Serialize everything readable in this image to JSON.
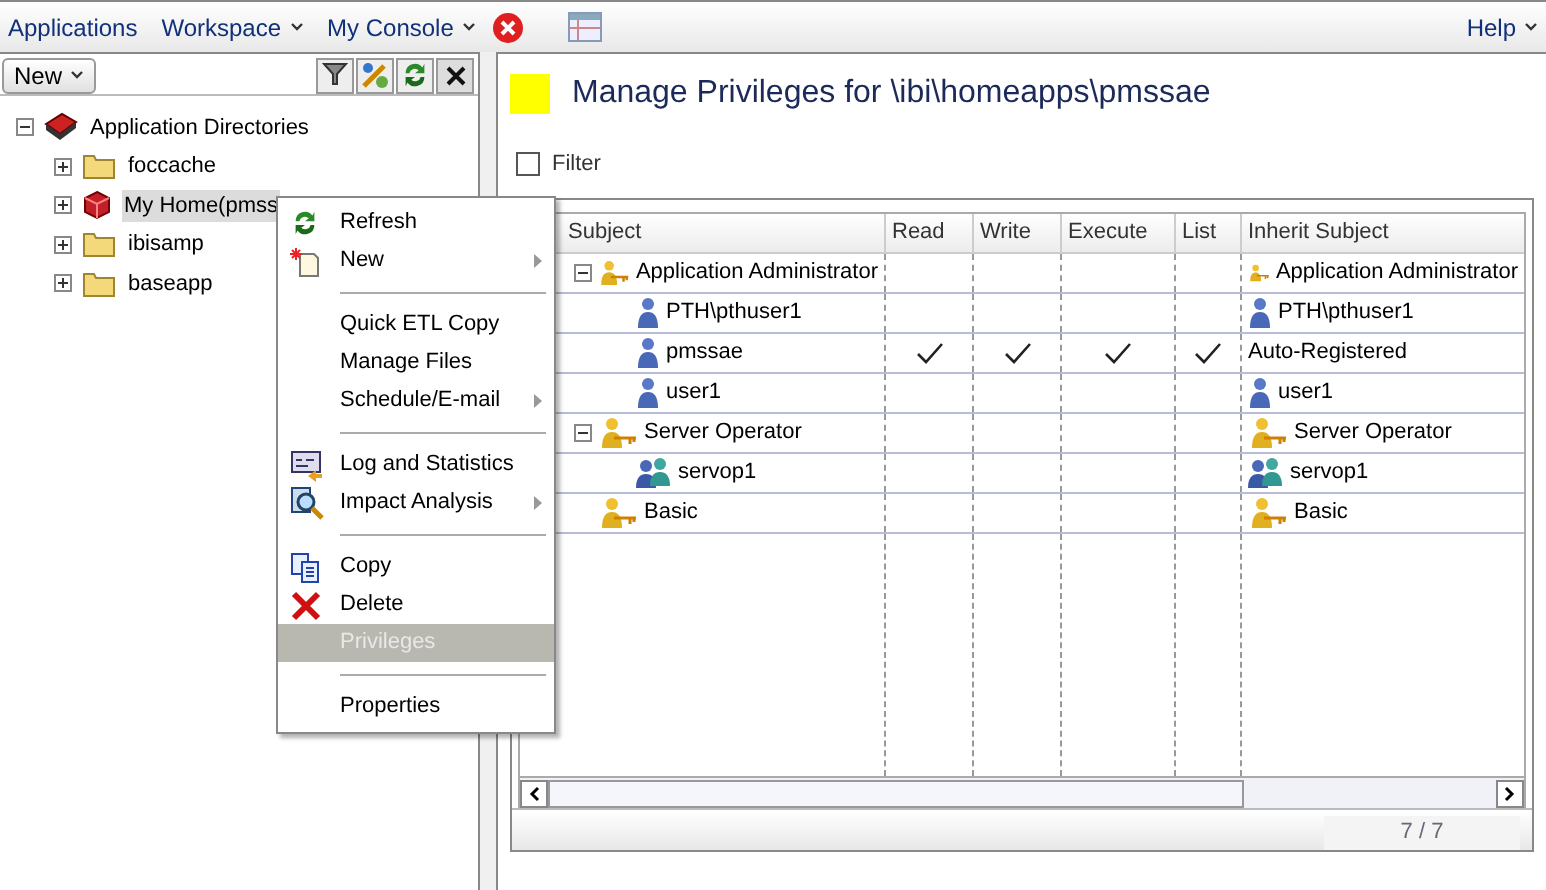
{
  "menu_bar": {
    "items": [
      {
        "label": "Applications",
        "dropdown": false
      },
      {
        "label": "Workspace",
        "dropdown": true
      },
      {
        "label": "My Console",
        "dropdown": true
      }
    ],
    "help": "Help"
  },
  "left_panel": {
    "new_button": "New",
    "tree": [
      {
        "label": "Application Directories",
        "kind": "root",
        "expanded": true,
        "selected": false,
        "children": [
          {
            "label": "foccache",
            "kind": "folder",
            "expanded": false,
            "selected": false
          },
          {
            "label": "My Home(pmss",
            "kind": "home",
            "expanded": false,
            "selected": true
          },
          {
            "label": "ibisamp",
            "kind": "folder",
            "expanded": false,
            "selected": false
          },
          {
            "label": "baseapp",
            "kind": "folder",
            "expanded": false,
            "selected": false
          }
        ]
      }
    ]
  },
  "context_menu": [
    {
      "kind": "item",
      "label": "Refresh",
      "submenu": false,
      "selected": false
    },
    {
      "kind": "item",
      "label": "New",
      "submenu": true,
      "selected": false
    },
    {
      "kind": "separator"
    },
    {
      "kind": "item",
      "label": "Quick ETL Copy",
      "submenu": false,
      "selected": false
    },
    {
      "kind": "item",
      "label": "Manage Files",
      "submenu": false,
      "selected": false
    },
    {
      "kind": "item",
      "label": "Schedule/E-mail",
      "submenu": true,
      "selected": false
    },
    {
      "kind": "separator"
    },
    {
      "kind": "item",
      "label": "Log and Statistics",
      "submenu": false,
      "selected": false
    },
    {
      "kind": "item",
      "label": "Impact Analysis",
      "submenu": true,
      "selected": false
    },
    {
      "kind": "separator"
    },
    {
      "kind": "item",
      "label": "Copy",
      "submenu": false,
      "selected": false
    },
    {
      "kind": "item",
      "label": "Delete",
      "submenu": false,
      "selected": false
    },
    {
      "kind": "item",
      "label": "Privileges",
      "submenu": false,
      "selected": true
    },
    {
      "kind": "separator"
    },
    {
      "kind": "item",
      "label": "Properties",
      "submenu": false,
      "selected": false
    }
  ],
  "privileges": {
    "title": "Manage Privileges for \\ibi\\homeapps\\pmssae",
    "filter": {
      "label": "Filter",
      "checked": false
    },
    "table": {
      "columns": [
        "Subject",
        "Read",
        "Write",
        "Execute",
        "List",
        "Inherit Subject"
      ],
      "rows": [
        {
          "subject": "Application Administrator",
          "kind": "role",
          "expanded": true,
          "inherit": "Application Administrator",
          "inherit_icon": true,
          "children": [
            {
              "subject": "PTH\\pthuser1",
              "kind": "user",
              "read": false,
              "write": false,
              "execute": false,
              "list": false,
              "inherit": "PTH\\pthuser1",
              "inherit_icon": true
            },
            {
              "subject": "pmssae",
              "kind": "user",
              "read": true,
              "write": true,
              "execute": true,
              "list": true,
              "inherit": "Auto-Registered",
              "inherit_icon": false
            },
            {
              "subject": "user1",
              "kind": "user",
              "read": false,
              "write": false,
              "execute": false,
              "list": false,
              "inherit": "user1",
              "inherit_icon": true
            }
          ]
        },
        {
          "subject": "Server Operator",
          "kind": "role",
          "expanded": true,
          "inherit": "Server Operator",
          "inherit_icon": true,
          "children": [
            {
              "subject": "servop1",
              "kind": "group",
              "read": false,
              "write": false,
              "execute": false,
              "list": false,
              "inherit": "servop1",
              "inherit_icon": true
            }
          ]
        },
        {
          "subject": "Basic",
          "kind": "role",
          "inherit": "Basic",
          "inherit_icon": true
        }
      ]
    },
    "pager": "7 / 7"
  }
}
